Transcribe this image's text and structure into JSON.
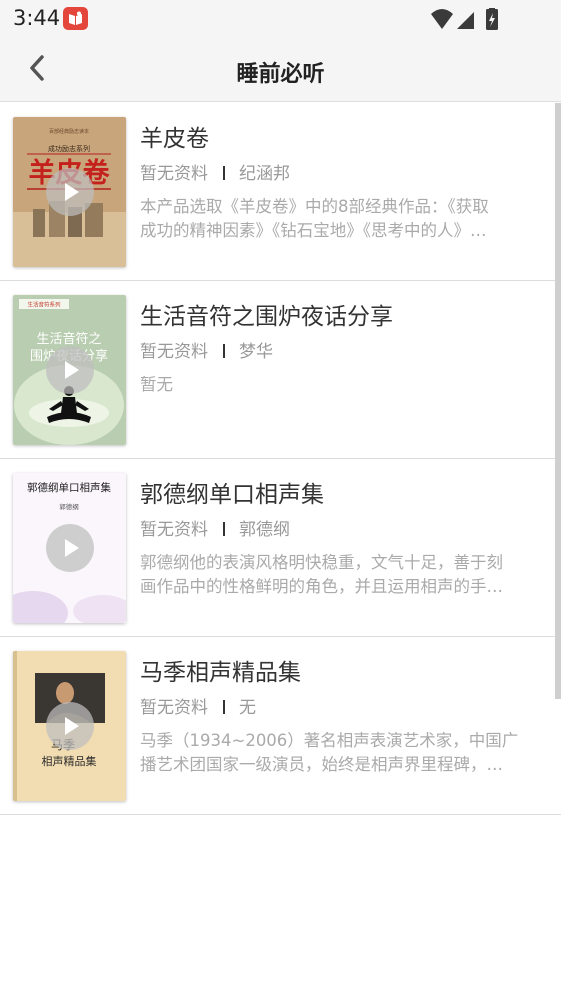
{
  "status_bar": {
    "time": "3:44",
    "icons": [
      "app-notification-icon",
      "wifi-icon",
      "cellular-signal-icon",
      "battery-charging-icon"
    ]
  },
  "header": {
    "title": "睡前必听",
    "back_icon": "chevron-left-icon"
  },
  "items": [
    {
      "title": "羊皮卷",
      "info": "暂无资料",
      "author": "纪涵邦",
      "desc_line1": "本产品选取《羊皮卷》中的8部经典作品：《获取",
      "desc_line2": "成功的精神因素》《钻石宝地》《思考中的人》…",
      "cover": {
        "top_text": "百部经典励志读本",
        "series": "成功励志系列",
        "main": "羊皮卷"
      }
    },
    {
      "title": "生活音符之围炉夜话分享",
      "info": "暂无资料",
      "author": "梦华",
      "desc_line1": "暂无",
      "desc_line2": "",
      "cover": {
        "tag": "生活音符系列",
        "main1": "生活音符之",
        "main2": "围炉夜话分享"
      }
    },
    {
      "title": "郭德纲单口相声集",
      "info": "暂无资料",
      "author": "郭德纲",
      "desc_line1": "郭德纲他的表演风格明快稳重，文气十足，善于刻",
      "desc_line2": "画作品中的性格鲜明的角色，并且运用相声的手…",
      "cover": {
        "main": "郭德纲单口相声集",
        "sub": "郭德纲"
      }
    },
    {
      "title": "马季相声精品集",
      "info": "暂无资料",
      "author": "无",
      "desc_line1": "马季（1934~2006）著名相声表演艺术家，中国广",
      "desc_line2": "播艺术团国家一级演员，始终是相声界里程碑，…",
      "cover": {
        "main1": "马季",
        "main2": "相声精品集"
      }
    }
  ]
}
